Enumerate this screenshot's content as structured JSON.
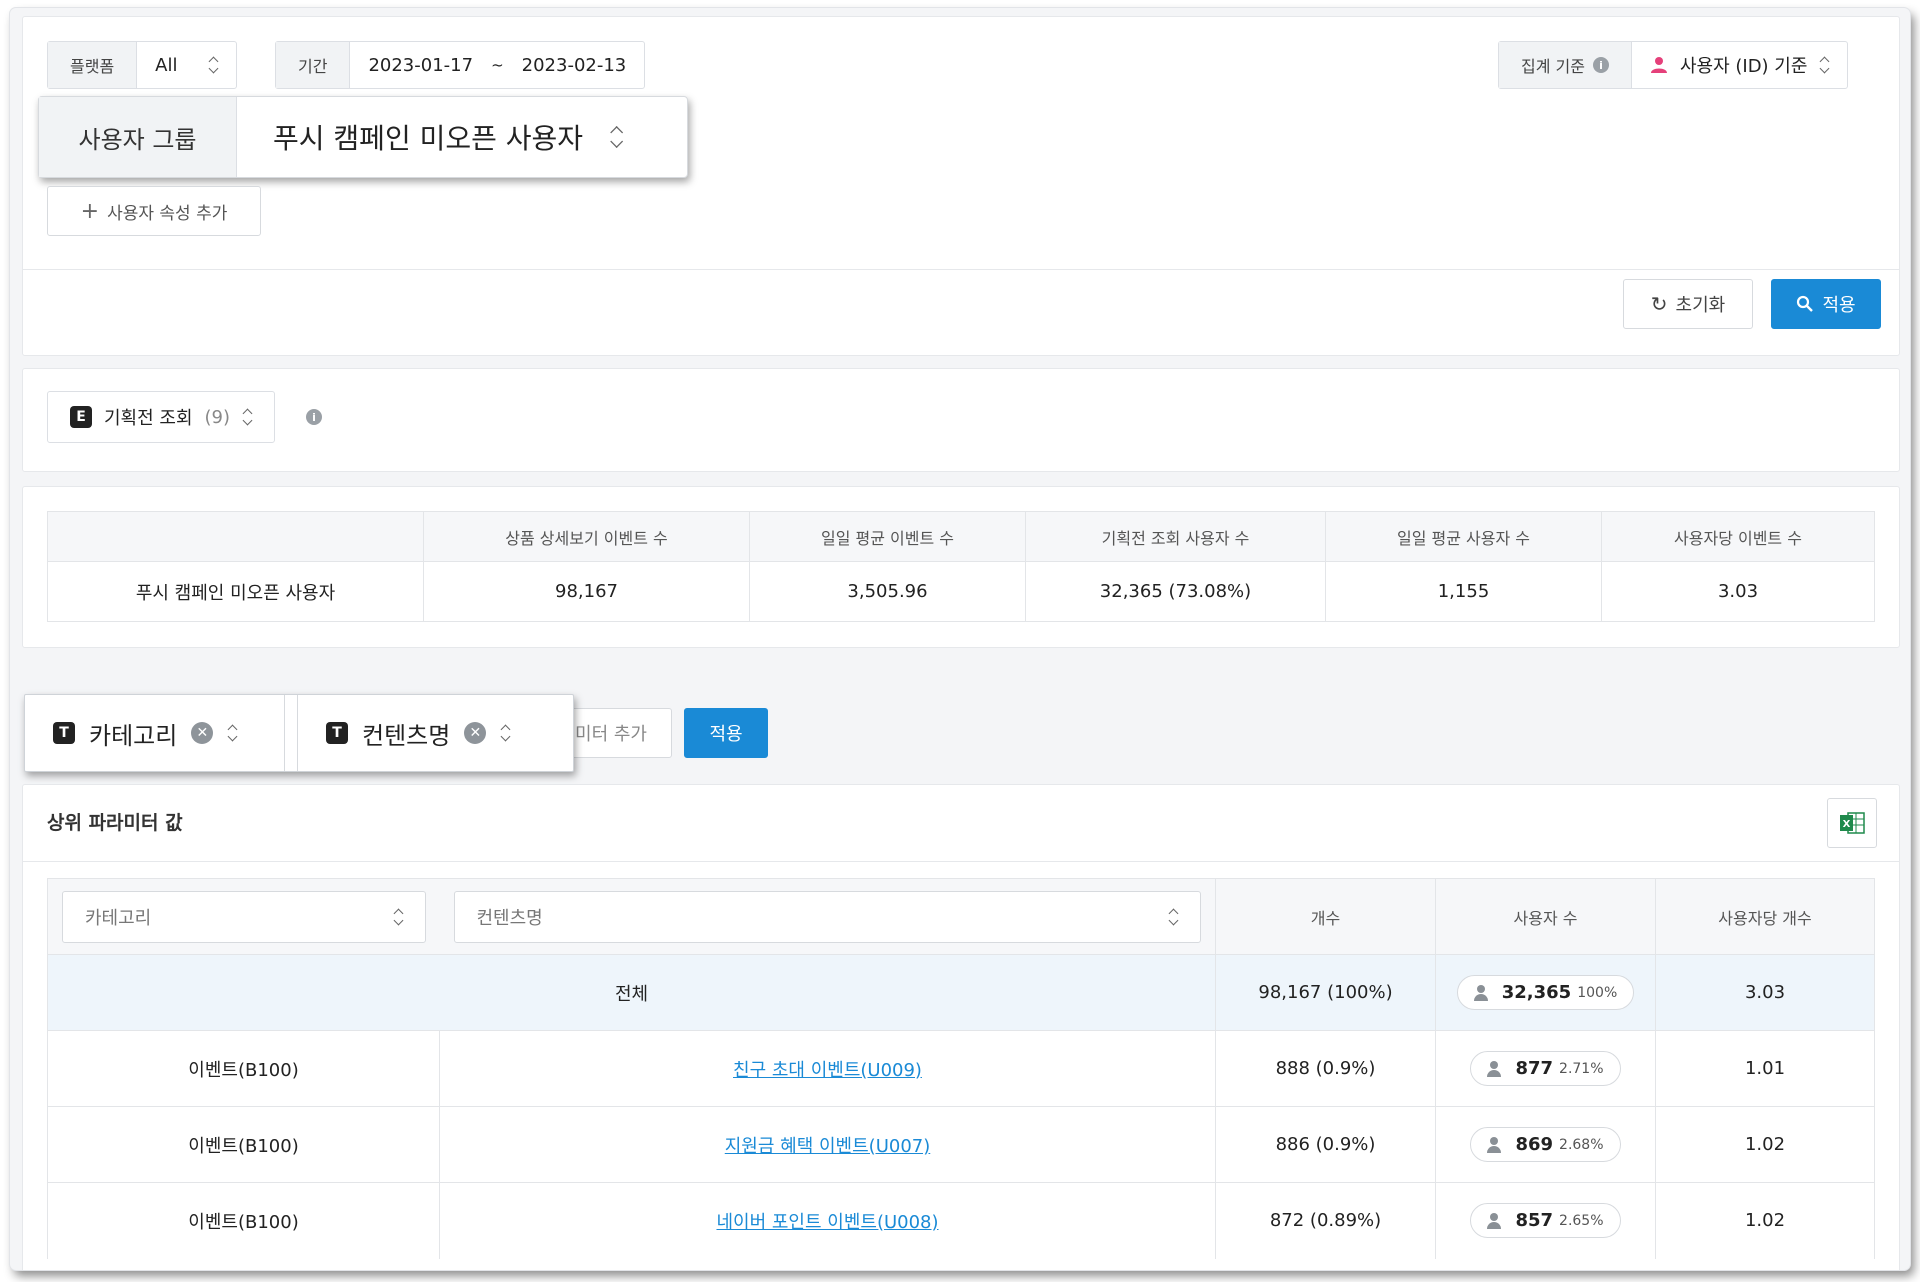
{
  "filters": {
    "platform_label": "플랫폼",
    "platform_value": "All",
    "period_label": "기간",
    "period_start": "2023-01-17",
    "period_sep": "~",
    "period_end": "2023-02-13",
    "agg_label": "집계 기준",
    "agg_value": "사용자 (ID) 기준",
    "user_group_label": "사용자 그룹",
    "user_group_value": "푸시 캠페인 미오픈 사용자",
    "add_attr_label": "사용자 속성 추가",
    "reset_label": "초기화",
    "apply_label": "적용"
  },
  "event": {
    "badge": "E",
    "name": "기획전 조회",
    "count": "(9)"
  },
  "summary": {
    "headers": [
      "",
      "상품 상세보기 이벤트 수",
      "일일 평균 이벤트 수",
      "기획전 조회 사용자 수",
      "일일 평균 사용자 수",
      "사용자당 이벤트 수"
    ],
    "row": [
      "푸시 캠페인 미오픈 사용자",
      "98,167",
      "3,505.96",
      "32,365 (73.08%)",
      "1,155",
      "3.03"
    ]
  },
  "params": {
    "chip1_badge": "T",
    "chip1_label": "카테고리",
    "chip2_badge": "T",
    "chip2_label": "컨텐츠명",
    "add_label": "미터 추가",
    "apply_label": "적용"
  },
  "top_params": {
    "title": "상위 파라미터 값",
    "excel_icon": "excel-icon",
    "col_category_placeholder": "카테고리",
    "col_content_placeholder": "컨텐츠명",
    "col_count": "개수",
    "col_users": "사용자 수",
    "col_per_user": "사용자당 개수",
    "total": {
      "label": "전체",
      "count": "98,167 (100%)",
      "users": "32,365",
      "users_pct": "100%",
      "per_user": "3.03"
    },
    "rows": [
      {
        "category": "이벤트(B100)",
        "content": "친구 초대 이벤트(U009)",
        "count": "888 (0.9%)",
        "users": "877",
        "users_pct": "2.71%",
        "per_user": "1.01"
      },
      {
        "category": "이벤트(B100)",
        "content": "지원금 혜택 이벤트(U007)",
        "count": "886 (0.9%)",
        "users": "869",
        "users_pct": "2.68%",
        "per_user": "1.02"
      },
      {
        "category": "이벤트(B100)",
        "content": "네이버 포인트 이벤트(U008)",
        "count": "872 (0.89%)",
        "users": "857",
        "users_pct": "2.65%",
        "per_user": "1.02"
      }
    ]
  },
  "colors": {
    "primary": "#1a8ad6",
    "user_icon": "#e5407a",
    "excel": "#1f8a4c"
  }
}
